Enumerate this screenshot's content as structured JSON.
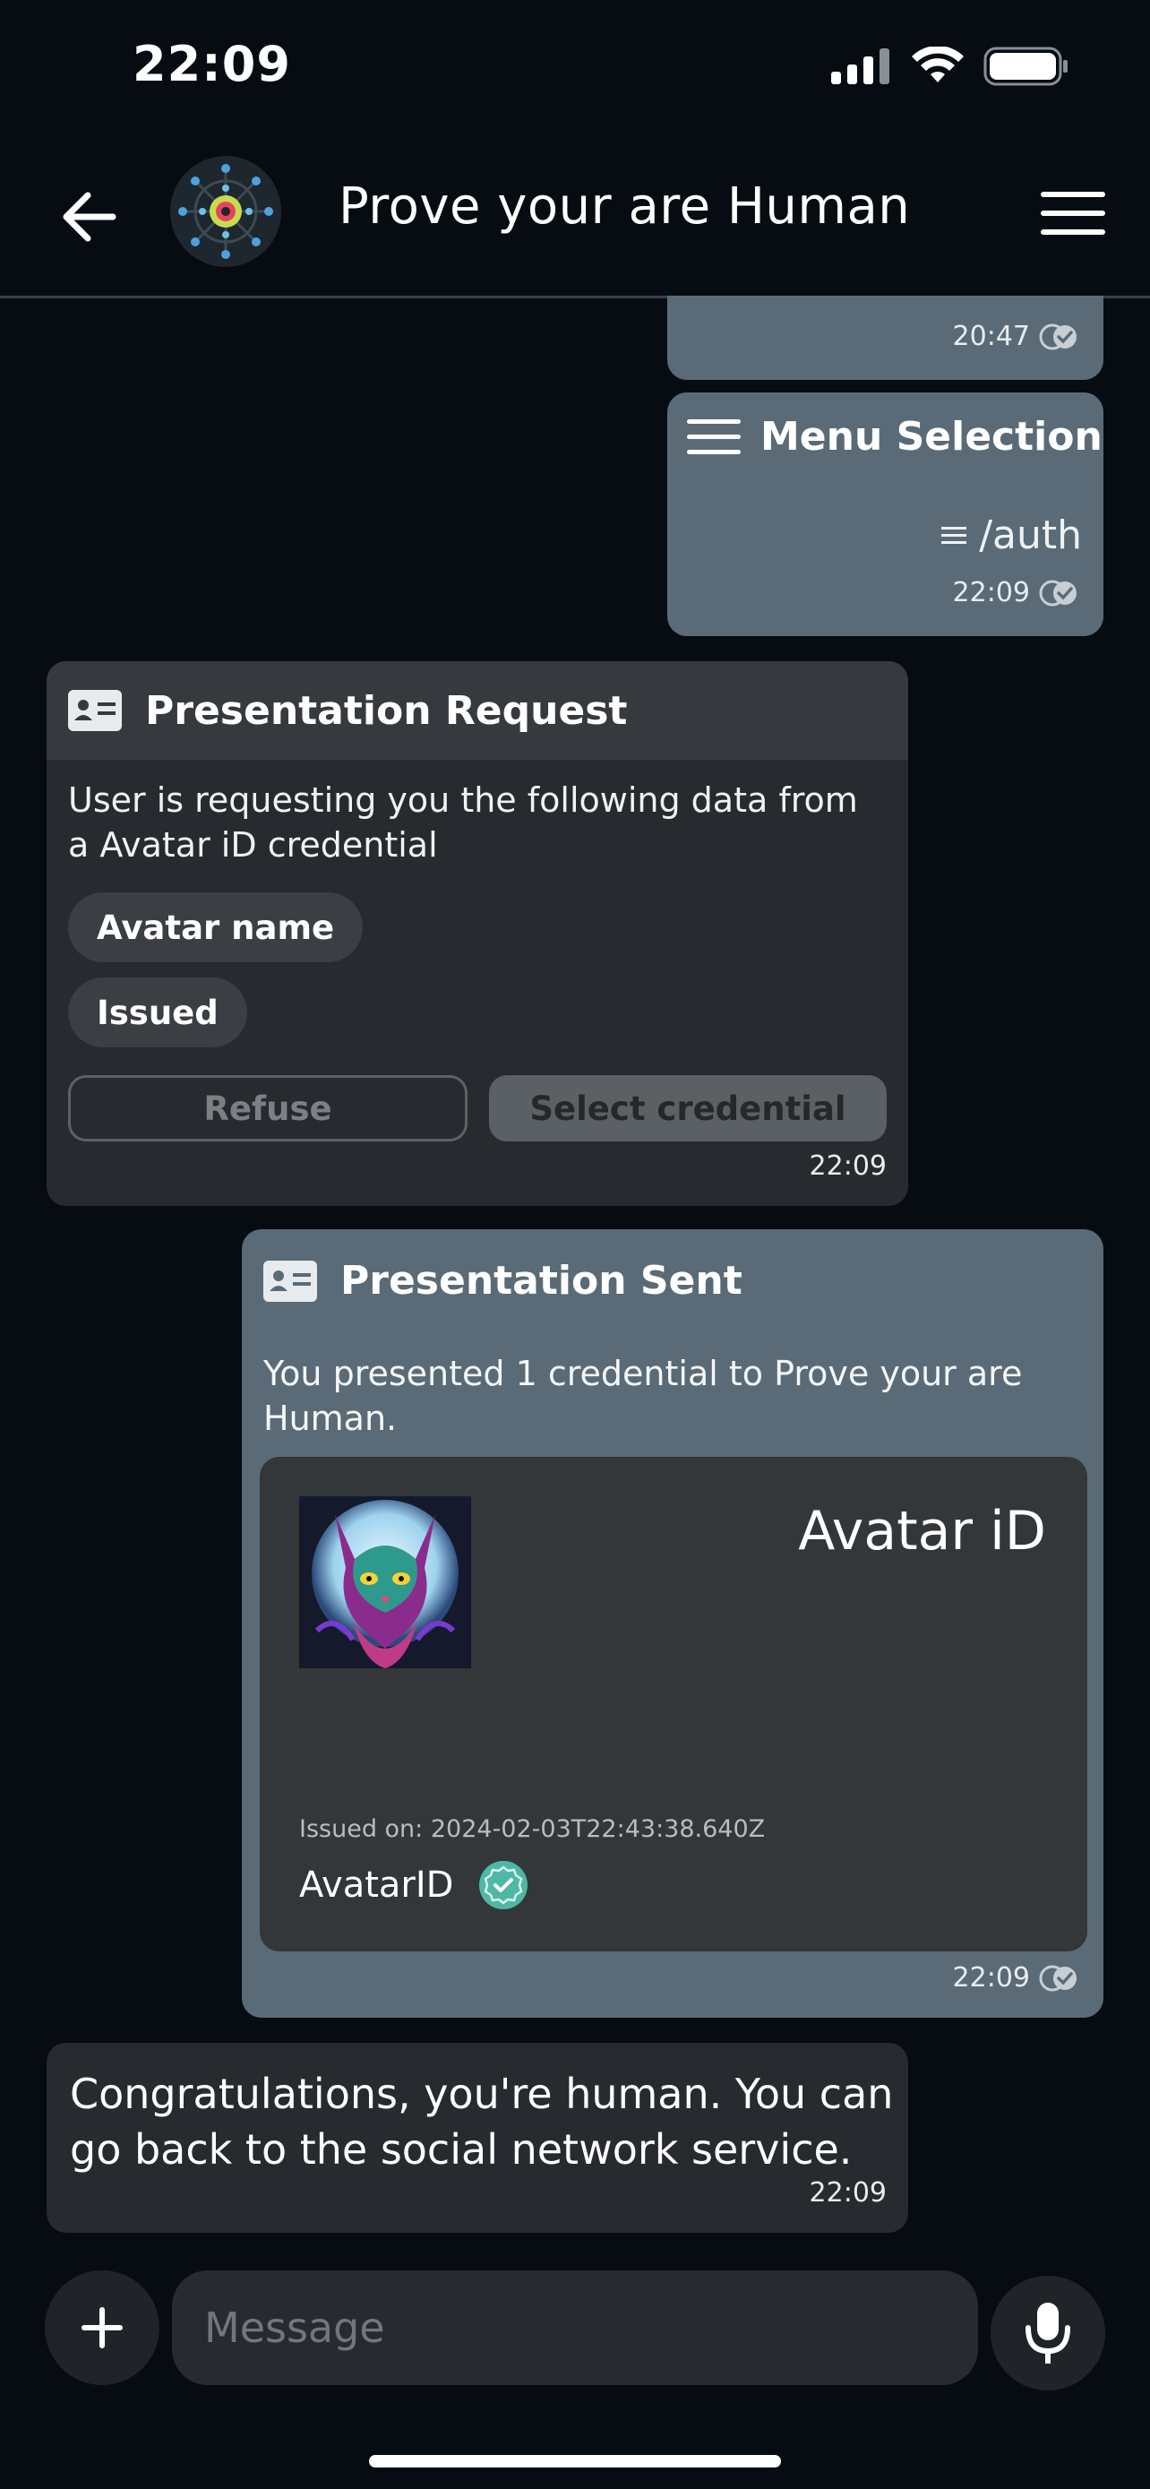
{
  "status_bar": {
    "time": "22:09"
  },
  "header": {
    "title": "Prove your are Human",
    "icons": [
      "back-arrow-icon",
      "bot-avatar",
      "hamburger-menu-icon"
    ]
  },
  "messages": {
    "prev": {
      "time": "20:47"
    },
    "menu_selection": {
      "title": "Menu Selection",
      "command": "/auth",
      "time": "22:09"
    },
    "presentation_request": {
      "title": "Presentation Request",
      "text": "User is requesting you the following data from a Avatar iD credential",
      "attributes": [
        "Avatar name",
        "Issued"
      ],
      "refuse_label": "Refuse",
      "select_label": "Select credential",
      "time": "22:09"
    },
    "presentation_sent": {
      "title": "Presentation Sent",
      "text": "You presented 1 credential to Prove your are Human.",
      "credential": {
        "title": "Avatar iD",
        "issued_on": "Issued on: 2024-02-03T22:43:38.640Z",
        "issuer": "AvatarID"
      },
      "time": "22:09"
    },
    "congrats": {
      "text": "Congratulations, you're human. You can go back to the social network service.",
      "time": "22:09"
    }
  },
  "composer": {
    "placeholder": "Message"
  },
  "colors": {
    "sent_bubble": "#5a6b77",
    "received_bubble": "#272a2e",
    "background": "#060c12",
    "verified": "#4fb7a5"
  }
}
